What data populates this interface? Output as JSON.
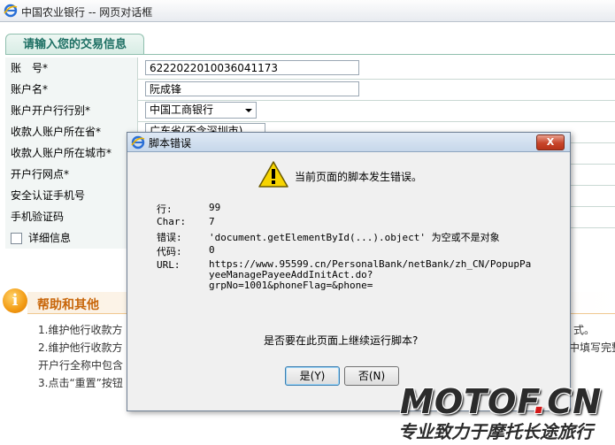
{
  "window": {
    "title": "中国农业银行 -- 网页对话框"
  },
  "form": {
    "section_title": "请输入您的交易信息",
    "rows": [
      {
        "label": "账　号*",
        "value": "6222022010036041173"
      },
      {
        "label": "账户名*",
        "value": "阮成锋"
      },
      {
        "label": "账户开户行行别*",
        "value": "中国工商银行"
      },
      {
        "label": "收款人账户所在省*",
        "value": "广东省(不含深圳市)"
      },
      {
        "label": "收款人账户所在城市*",
        "value": ""
      },
      {
        "label": "开户行网点*",
        "value": ""
      },
      {
        "label": "安全认证手机号",
        "value": ""
      },
      {
        "label": "手机验证码",
        "value": ""
      }
    ],
    "detail_checkbox_label": "详细信息"
  },
  "help": {
    "icon_glyph": "i",
    "title": "帮助和其他",
    "lines": [
      "1.维护他行收款方",
      "2.维护他行收款方",
      "开户行全称中包含",
      "3.点击“重置”按钮"
    ],
    "right_fragments": [
      "式。",
      "中填写完整"
    ]
  },
  "dialog": {
    "title": "脚本错误",
    "close_glyph": "X",
    "message": "当前页面的脚本发生错误。",
    "details": [
      {
        "key": "行:",
        "value": "99"
      },
      {
        "key": "Char:",
        "value": "7"
      },
      {
        "key": "错误:",
        "value": "'document.getElementById(...).object' 为空或不是对象"
      },
      {
        "key": "代码:",
        "value": "0"
      },
      {
        "key": "URL:",
        "value": "https://www.95599.cn/PersonalBank/netBank/zh_CN/PopupPa\nyeeManagePayeeAddInitAct.do?\ngrpNo=1001&phoneFlag=&phone="
      }
    ],
    "question": "是否要在此页面上继续运行脚本?",
    "yes_label": "是(Y)",
    "no_label": "否(N)"
  },
  "watermark": {
    "brand_main": "MOTOF",
    "brand_dot": ".",
    "brand_tld": "CN",
    "slogan": "专业致力于摩托长途旅行"
  },
  "colors": {
    "form_accent": "#1d6f63",
    "help_accent": "#c8660a",
    "warning_yellow": "#f7d400",
    "close_red": "#c7452a"
  }
}
